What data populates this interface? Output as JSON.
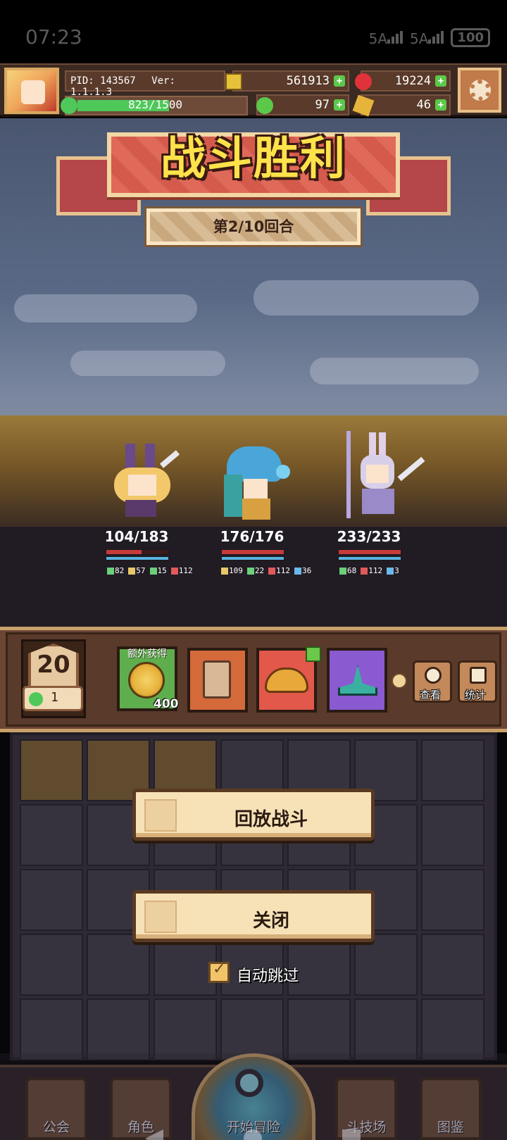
{
  "status_bar": {
    "time": "07:23",
    "signal1": "5A",
    "signal2": "5A",
    "battery": "100"
  },
  "top_bar": {
    "pid": "PID: 143567",
    "version": "Ver: 1.1.1.3",
    "xp": "823/1500",
    "xp_fraction": 0.549,
    "gold": "561913",
    "gems": "19224",
    "clover": "97",
    "tickets": "46"
  },
  "banner": {
    "title": "战斗胜利",
    "round": "第2/10回合"
  },
  "heroes": [
    {
      "hp": "104/183",
      "hp_fraction": 0.568,
      "stats": [
        "82",
        "57",
        "15",
        "112"
      ]
    },
    {
      "hp": "176/176",
      "hp_fraction": 1.0,
      "stats": [
        "109",
        "22",
        "112",
        "36"
      ]
    },
    {
      "hp": "233/233",
      "hp_fraction": 1.0,
      "stats": [
        "68",
        "112",
        "3"
      ]
    }
  ],
  "panel": {
    "level": "20",
    "clover_count": "1",
    "extra_tag": "额外获得",
    "coin_qty": "400",
    "view_label": "查看",
    "stats_label": "统计"
  },
  "modal": {
    "replay_label": "回放战斗",
    "close_label": "关闭",
    "auto_skip_label": "自动跳过",
    "auto_skip_checked": true
  },
  "nav": {
    "guild": "公会",
    "character": "角色",
    "adventure": "开始冒险",
    "arena": "斗技场",
    "codex": "图鉴"
  },
  "colors": {
    "title_yellow": "#fde24a",
    "banner_red": "#e06a5a",
    "hp_red": "#c73a3a",
    "shield_blue": "#5ab3e0",
    "xp_green": "#4fc85a"
  }
}
